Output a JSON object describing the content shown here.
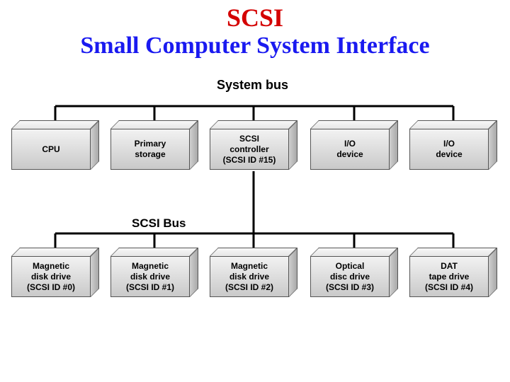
{
  "title_line1": "SCSI",
  "title_line2": "Small Computer System Interface",
  "labels": {
    "system_bus": "System bus",
    "scsi_bus": "SCSI Bus"
  },
  "system_bus_nodes": [
    {
      "name": "cpu",
      "label": "CPU"
    },
    {
      "name": "primary-storage",
      "label": "Primary\nstorage"
    },
    {
      "name": "scsi-controller",
      "label": "SCSI\ncontroller\n(SCSI ID #15)"
    },
    {
      "name": "io-device-1",
      "label": "I/O\ndevice"
    },
    {
      "name": "io-device-2",
      "label": "I/O\ndevice"
    }
  ],
  "scsi_bus_nodes": [
    {
      "name": "magnetic-disk-0",
      "label": "Magnetic\ndisk drive\n(SCSI ID #0)"
    },
    {
      "name": "magnetic-disk-1",
      "label": "Magnetic\ndisk drive\n(SCSI ID #1)"
    },
    {
      "name": "magnetic-disk-2",
      "label": "Magnetic\ndisk drive\n(SCSI ID #2)"
    },
    {
      "name": "optical-disc-3",
      "label": "Optical\ndisc drive\n(SCSI ID #3)"
    },
    {
      "name": "dat-tape-4",
      "label": "DAT\ntape drive\n(SCSI ID #4)"
    }
  ]
}
